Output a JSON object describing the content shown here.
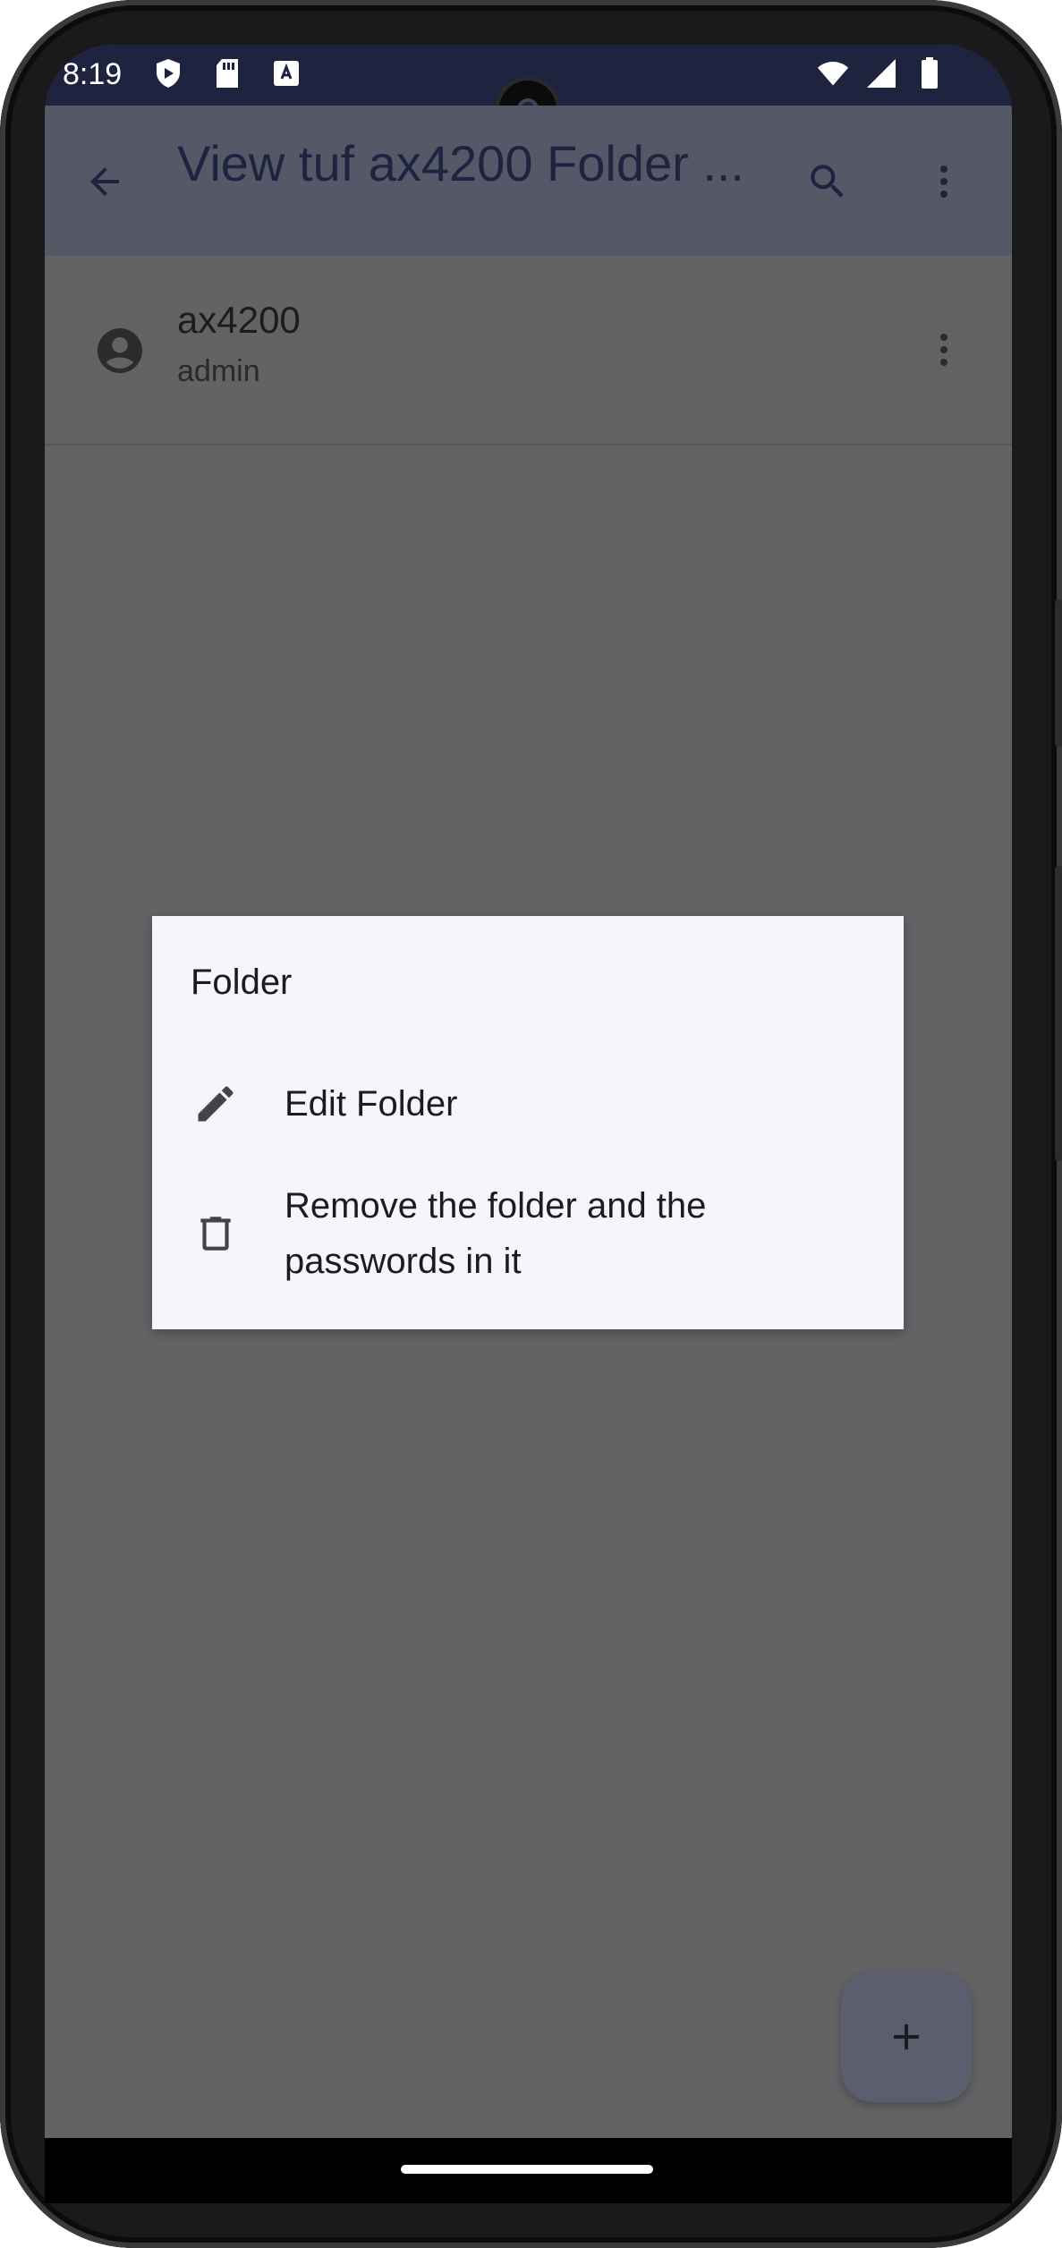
{
  "status_bar": {
    "time": "8:19",
    "left_icons": [
      "shield-icon",
      "sd-card-icon",
      "keyboard-a-icon"
    ],
    "right_icons": [
      "wifi-icon",
      "signal-icon",
      "battery-icon"
    ]
  },
  "app_bar": {
    "title": "View tuf ax4200 Folder ...",
    "back_icon": "arrow-back-icon",
    "search_icon": "search-icon",
    "more_icon": "more-vert-icon"
  },
  "list": {
    "items": [
      {
        "title": "ax4200",
        "subtitle": "admin",
        "icon": "account-circle-icon"
      }
    ]
  },
  "dialog": {
    "title": "Folder",
    "items": [
      {
        "label": "Edit Folder",
        "icon": "edit-icon"
      },
      {
        "label": "Remove the folder and the passwords in it",
        "icon": "delete-icon"
      }
    ]
  },
  "fab": {
    "icon": "add-icon"
  },
  "colors": {
    "status_bar": "#1e2340",
    "app_bar_scrim": "#545867",
    "screen_scrim": "#636366",
    "dialog_bg": "#f6f5fb"
  }
}
